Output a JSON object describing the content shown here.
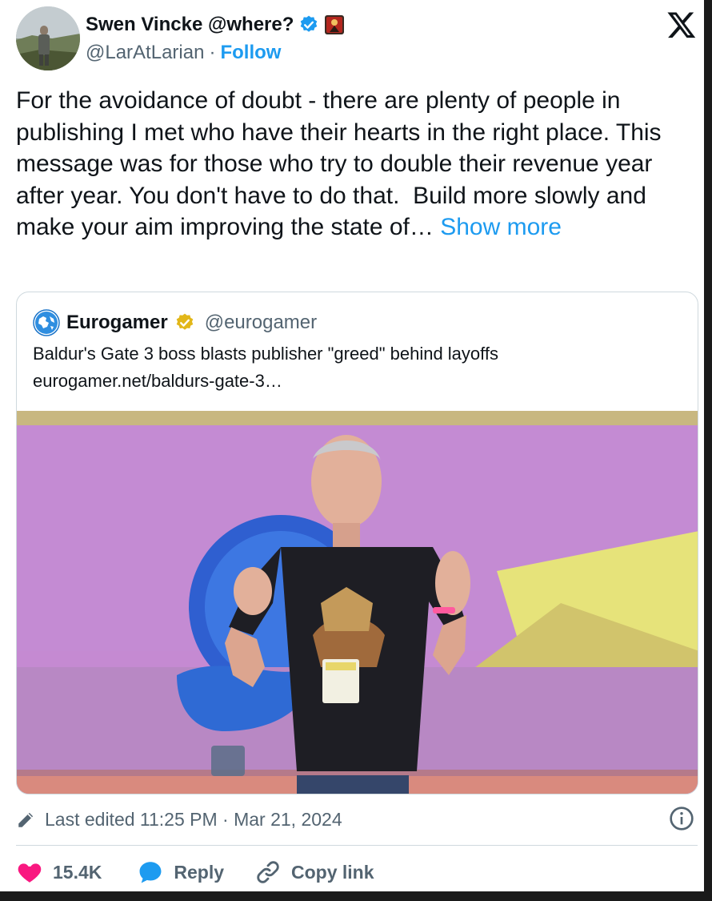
{
  "author": {
    "name": "Swen Vincke @where?",
    "handle": "@LarAtLarian",
    "separator": "·",
    "follow_label": "Follow"
  },
  "tweet": {
    "text": "For the avoidance of doubt - there are plenty of people in publishing I met who have their hearts in the right place. This message was for those who try to double their revenue year after year. You don't have to do that.  Build more slowly and make your aim improving the state of… ",
    "show_more_label": "Show more"
  },
  "quote": {
    "name": "Eurogamer",
    "handle": "@eurogamer",
    "title": "Baldur's Gate 3 boss blasts publisher \"greed\" behind layoffs",
    "link": "eurogamer.net/baldurs-gate-3…"
  },
  "meta": {
    "edited_text": "Last edited 11:25 PM · Mar 21, 2024"
  },
  "actions": {
    "likes": "15.4K",
    "reply_label": "Reply",
    "copy_link_label": "Copy link"
  },
  "colors": {
    "accent": "#1d9bf0",
    "secondary_text": "#536471",
    "like": "#f91880",
    "verified_blue": "#1d9bf0",
    "verified_gold": "#e2b719",
    "border": "#cfd9de"
  },
  "icons": {
    "verified": "verified-badge-icon",
    "x_logo": "x-logo-icon",
    "edit": "pencil-icon",
    "info": "info-icon",
    "like": "heart-icon",
    "reply": "reply-bubble-icon",
    "copy_link": "link-icon"
  }
}
